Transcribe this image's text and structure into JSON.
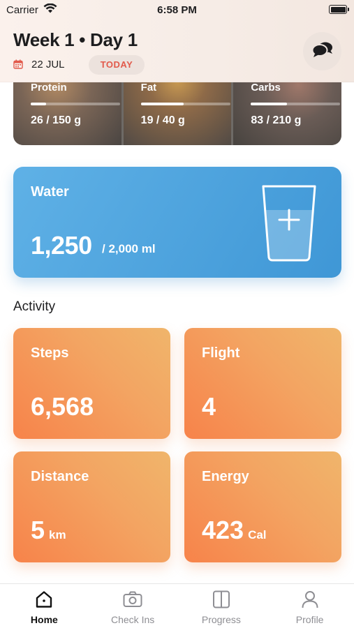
{
  "status_bar": {
    "carrier": "Carrier",
    "time": "6:58 PM"
  },
  "header": {
    "title": "Week 1 • Day 1",
    "date": "22 JUL",
    "today_label": "TODAY"
  },
  "macros": [
    {
      "label": "Protein",
      "value": "26 / 150 g",
      "progress": 0.17
    },
    {
      "label": "Fat",
      "value": "19 / 40 g",
      "progress": 0.48
    },
    {
      "label": "Carbs",
      "value": "83 / 210 g",
      "progress": 0.4
    }
  ],
  "water": {
    "label": "Water",
    "amount": "1,250",
    "goal": "/ 2,000 ml",
    "fill": 0.625
  },
  "activity": {
    "section_title": "Activity",
    "cards": [
      {
        "label": "Steps",
        "value": "6,568",
        "unit": ""
      },
      {
        "label": "Flight",
        "value": "4",
        "unit": ""
      },
      {
        "label": "Distance",
        "value": "5",
        "unit": "km"
      },
      {
        "label": "Energy",
        "value": "423",
        "unit": "Cal"
      }
    ]
  },
  "tabbar": {
    "items": [
      {
        "label": "Home",
        "icon": "home-icon",
        "active": true
      },
      {
        "label": "Check Ins",
        "icon": "camera-icon",
        "active": false
      },
      {
        "label": "Progress",
        "icon": "progress-icon",
        "active": false
      },
      {
        "label": "Profile",
        "icon": "profile-icon",
        "active": false
      }
    ]
  },
  "colors": {
    "accent_today": "#e25a4b",
    "water": "#3f97d6",
    "activity": "#f7834a"
  }
}
